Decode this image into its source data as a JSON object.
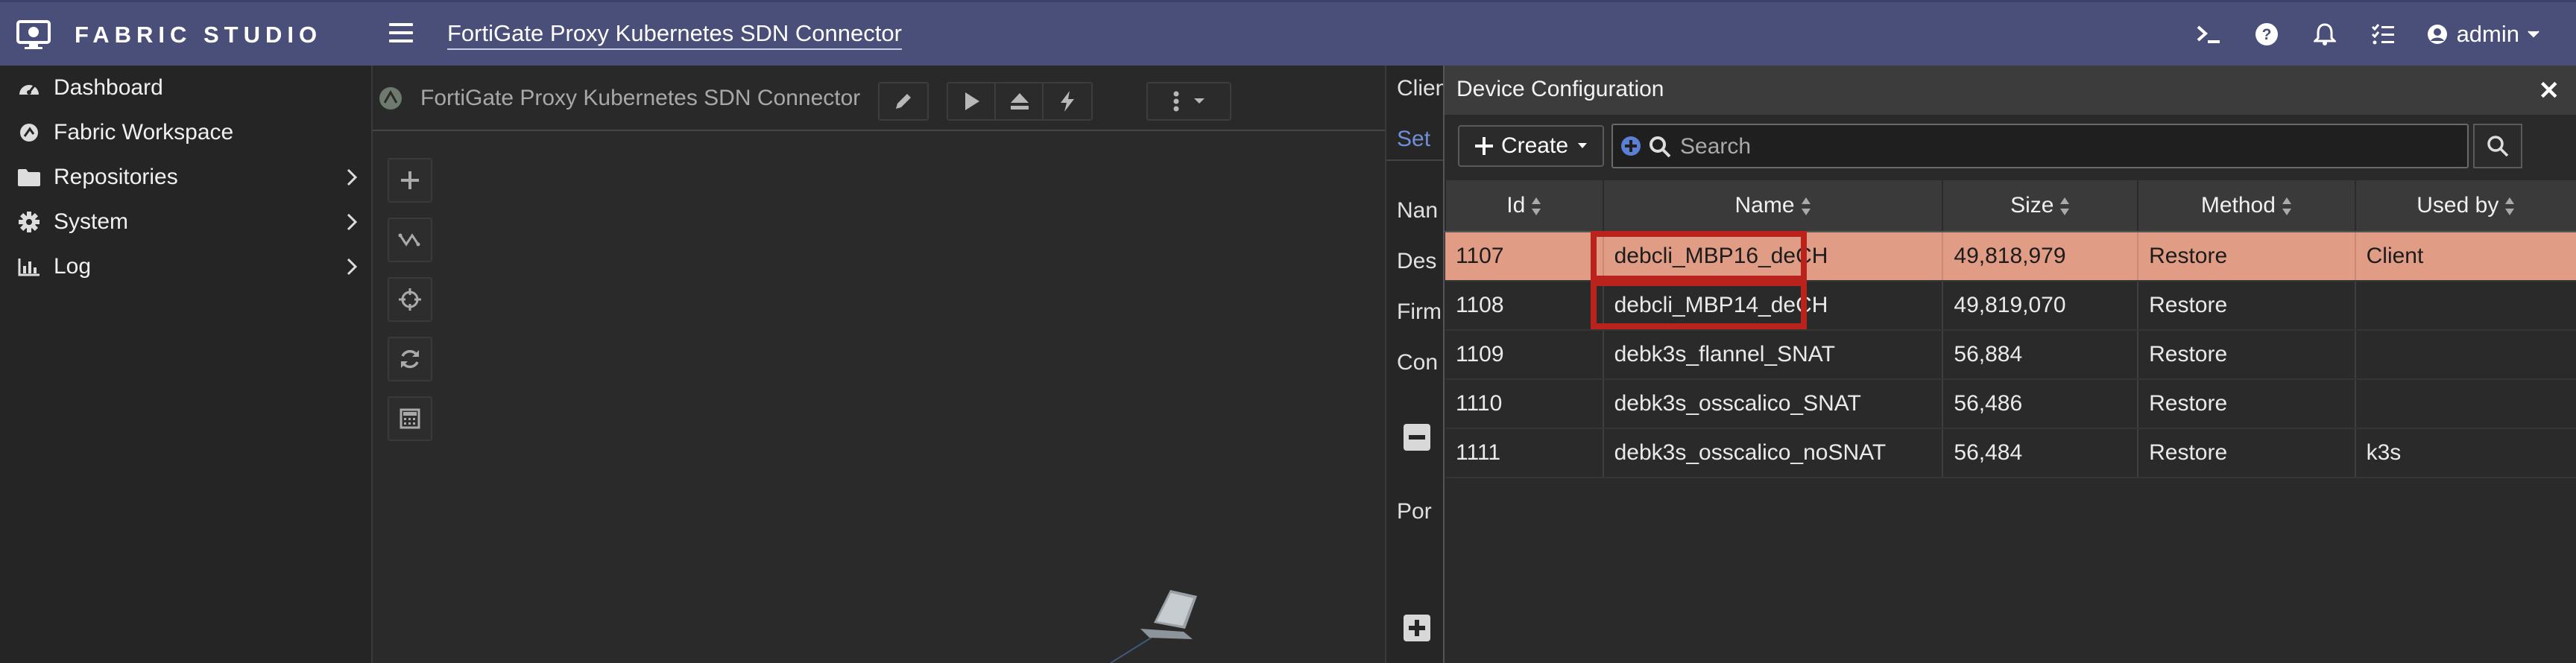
{
  "app": {
    "brand": "FABRIC STUDIO",
    "breadcrumb_title": "FortiGate Proxy Kubernetes SDN Connector",
    "user_label": "admin",
    "accent_color": "#4a4f7a"
  },
  "sidebar": {
    "items": [
      {
        "label": "Dashboard",
        "icon": "dashboard-icon"
      },
      {
        "label": "Fabric Workspace",
        "icon": "workspace-icon"
      },
      {
        "label": "Repositories",
        "icon": "folder-icon"
      },
      {
        "label": "System",
        "icon": "gear-icon"
      },
      {
        "label": "Log",
        "icon": "chart-icon"
      }
    ]
  },
  "workspace": {
    "title": "FortiGate Proxy Kubernetes SDN Connector"
  },
  "client_panel": {
    "title_fragment": "Clien",
    "tab_fragment": "Set",
    "rows": [
      "Nan",
      "Des",
      "Firm",
      "Con",
      "Por"
    ]
  },
  "dialog": {
    "title": "Device Configuration",
    "create_label": "Create",
    "search_placeholder": "Search",
    "columns": [
      "Id",
      "Name",
      "Size",
      "Method",
      "Used by"
    ],
    "rows": [
      {
        "id": "1107",
        "name": "debcli_MBP16_deCH",
        "size": "49,818,979",
        "method": "Restore",
        "used_by": "Client"
      },
      {
        "id": "1108",
        "name": "debcli_MBP14_deCH",
        "size": "49,819,070",
        "method": "Restore",
        "used_by": ""
      },
      {
        "id": "1109",
        "name": "debk3s_flannel_SNAT",
        "size": "56,884",
        "method": "Restore",
        "used_by": ""
      },
      {
        "id": "1110",
        "name": "debk3s_osscalico_SNAT",
        "size": "56,486",
        "method": "Restore",
        "used_by": ""
      },
      {
        "id": "1111",
        "name": "debk3s_osscalico_noSNAT",
        "size": "56,484",
        "method": "Restore",
        "used_by": "k3s"
      }
    ],
    "selected_row_color": "#e09c84",
    "highlight_color": "#b9231b"
  }
}
